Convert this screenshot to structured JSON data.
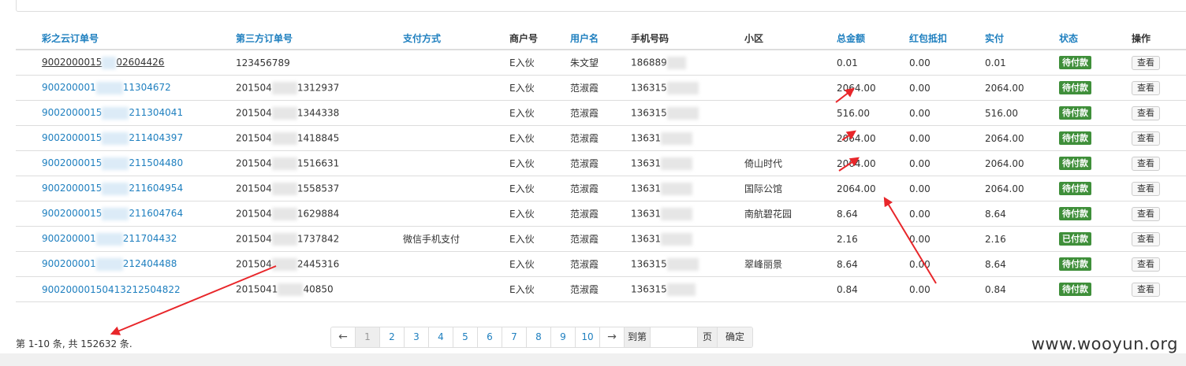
{
  "headers": [
    "彩之云订单号",
    "第三方订单号",
    "支付方式",
    "商户号",
    "用户名",
    "手机号码",
    "小区",
    "总金额",
    "红包抵扣",
    "实付",
    "状态",
    "操作"
  ],
  "rows": [
    {
      "order_a": "9002000015",
      "order_b": "02604426",
      "third_a": "123456789",
      "third_b": "",
      "pay": "",
      "merchant": "E入伙",
      "user": "朱文望",
      "phone": "186889",
      "community": "",
      "total": "0.01",
      "coupon": "0.00",
      "paid": "0.01",
      "status": "待付款",
      "action": "查看"
    },
    {
      "order_a": "900200001",
      "order_b": "11304672",
      "third_a": "201504",
      "third_b": "1312937",
      "pay": "",
      "merchant": "E入伙",
      "user": "范淑霞",
      "phone": "136315",
      "community": "",
      "total": "2064.00",
      "coupon": "0.00",
      "paid": "2064.00",
      "status": "待付款",
      "action": "查看"
    },
    {
      "order_a": "9002000015",
      "order_b": "211304041",
      "third_a": "201504",
      "third_b": "1344338",
      "pay": "",
      "merchant": "E入伙",
      "user": "范淑霞",
      "phone": "136315",
      "community": "",
      "total": "516.00",
      "coupon": "0.00",
      "paid": "516.00",
      "status": "待付款",
      "action": "查看"
    },
    {
      "order_a": "9002000015",
      "order_b": "211404397",
      "third_a": "201504",
      "third_b": "1418845",
      "pay": "",
      "merchant": "E入伙",
      "user": "范淑霞",
      "phone": "13631",
      "community": "",
      "total": "2064.00",
      "coupon": "0.00",
      "paid": "2064.00",
      "status": "待付款",
      "action": "查看"
    },
    {
      "order_a": "9002000015",
      "order_b": "211504480",
      "third_a": "201504",
      "third_b": "1516631",
      "pay": "",
      "merchant": "E入伙",
      "user": "范淑霞",
      "phone": "13631",
      "community": "倚山时代",
      "total": "2064.00",
      "coupon": "0.00",
      "paid": "2064.00",
      "status": "待付款",
      "action": "查看"
    },
    {
      "order_a": "9002000015",
      "order_b": "211604954",
      "third_a": "201504",
      "third_b": "1558537",
      "pay": "",
      "merchant": "E入伙",
      "user": "范淑霞",
      "phone": "13631",
      "community": "国际公馆",
      "total": "2064.00",
      "coupon": "0.00",
      "paid": "2064.00",
      "status": "待付款",
      "action": "查看"
    },
    {
      "order_a": "9002000015",
      "order_b": "211604764",
      "third_a": "201504",
      "third_b": "1629884",
      "pay": "",
      "merchant": "E入伙",
      "user": "范淑霞",
      "phone": "13631",
      "community": "南航碧花园",
      "total": "8.64",
      "coupon": "0.00",
      "paid": "8.64",
      "status": "待付款",
      "action": "查看"
    },
    {
      "order_a": "900200001",
      "order_b": "211704432",
      "third_a": "201504",
      "third_b": "1737842",
      "pay": "微信手机支付",
      "merchant": "E入伙",
      "user": "范淑霞",
      "phone": "13631",
      "community": "",
      "total": "2.16",
      "coupon": "0.00",
      "paid": "2.16",
      "status": "已付款",
      "action": "查看"
    },
    {
      "order_a": "900200001",
      "order_b": "212404488",
      "third_a": "201504",
      "third_b": "2445316",
      "pay": "",
      "merchant": "E入伙",
      "user": "范淑霞",
      "phone": "136315",
      "community": "翠峰丽景",
      "total": "8.64",
      "coupon": "0.00",
      "paid": "8.64",
      "status": "待付款",
      "action": "查看"
    },
    {
      "order_a": "900200001504132125048",
      "order_b": "22",
      "third_a": "2015041",
      "third_b": "40850",
      "pay": "",
      "merchant": "E入伙",
      "user": "范淑霞",
      "phone": "136315",
      "community": "",
      "total": "0.84",
      "coupon": "0.00",
      "paid": "0.84",
      "status": "待付款",
      "action": "查看"
    }
  ],
  "footer": {
    "summary": "第 1-10 条, 共 152632 条."
  },
  "pagination": {
    "prev": "←",
    "pages": [
      "1",
      "2",
      "3",
      "4",
      "5",
      "6",
      "7",
      "8",
      "9",
      "10"
    ],
    "next": "→",
    "goto_label": "到第",
    "page_unit": "页",
    "confirm": "确定",
    "active_page": "1"
  },
  "watermark": "www.wooyun.org",
  "colors": {
    "link": "#1e7fbf",
    "status_badge": "#3f8f3a",
    "arrow": "#e8262a"
  }
}
